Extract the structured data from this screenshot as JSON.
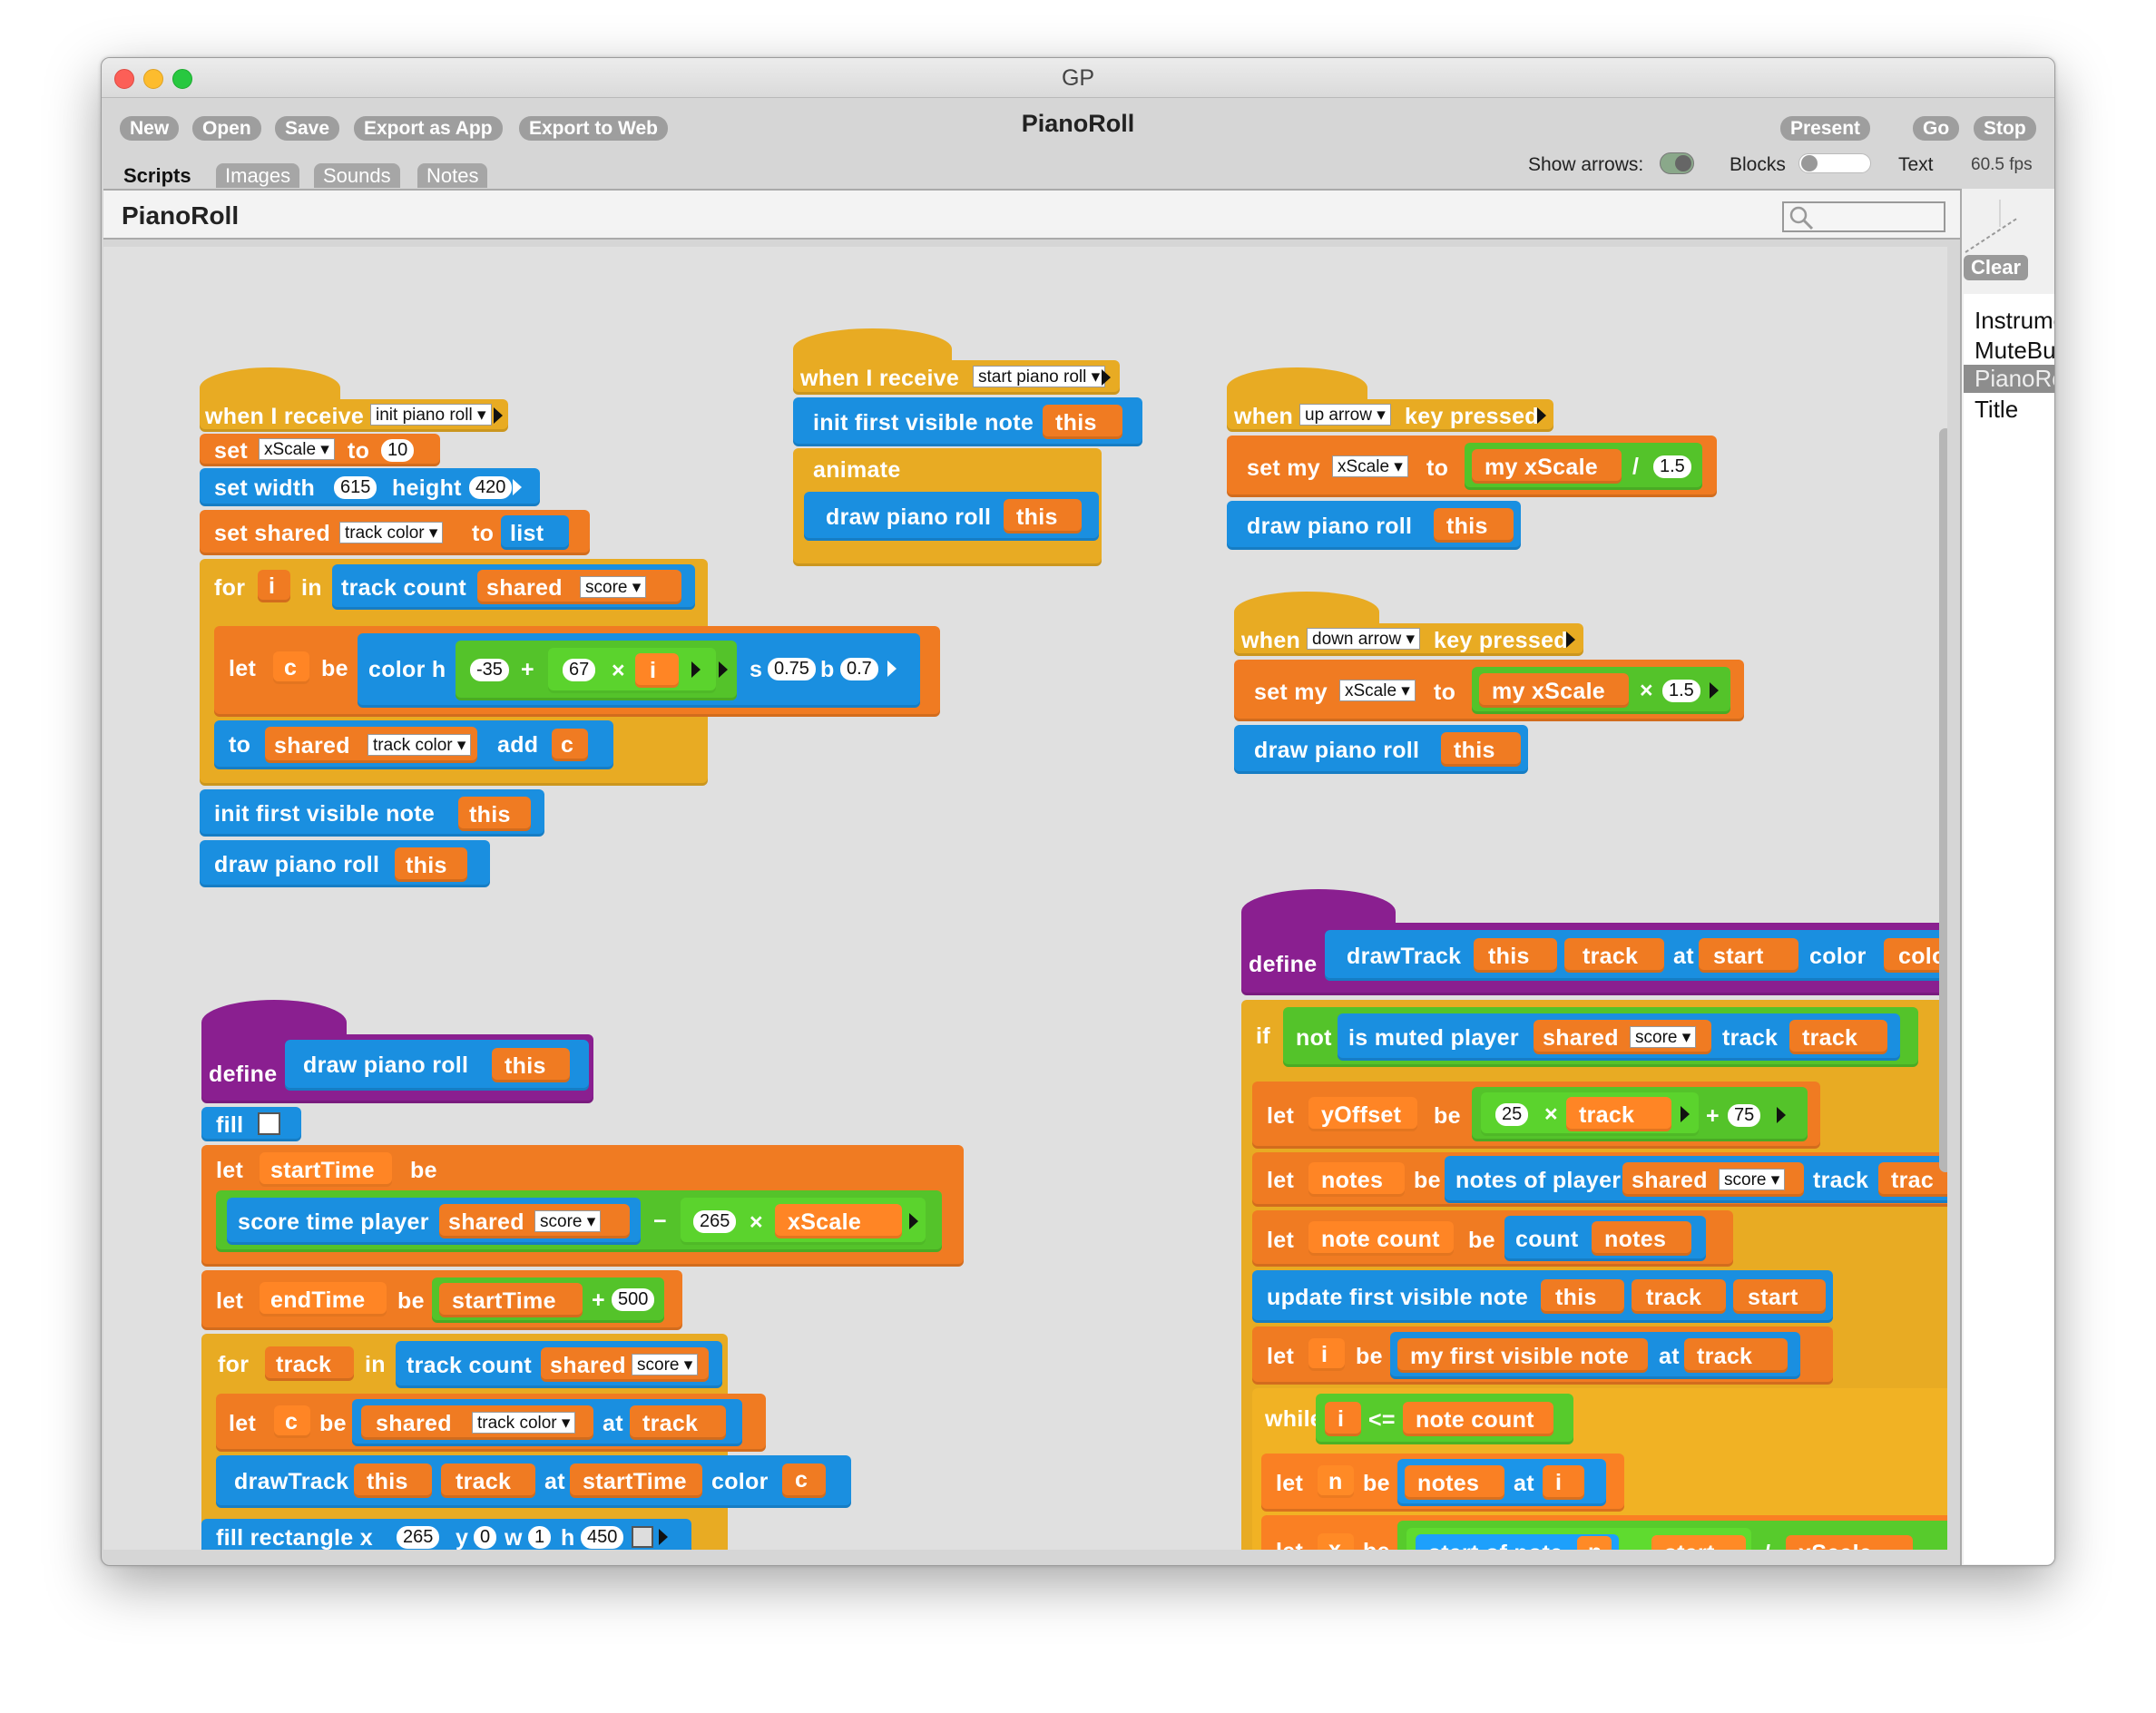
{
  "window": {
    "title": "GP",
    "project_name": "PianoRoll"
  },
  "toolbar": {
    "new": "New",
    "open": "Open",
    "save": "Save",
    "export_app": "Export as App",
    "export_web": "Export to Web",
    "present": "Present",
    "go": "Go",
    "stop": "Stop"
  },
  "tabs": {
    "scripts": "Scripts",
    "images": "Images",
    "sounds": "Sounds",
    "notes": "Notes"
  },
  "controls": {
    "show_arrows": "Show arrows:",
    "blocks": "Blocks",
    "text": "Text",
    "fps": "60.5 fps"
  },
  "header": {
    "class_name": "PianoRoll"
  },
  "right": {
    "clear": "Clear",
    "items": [
      "Instrume",
      "MuteBu",
      "PianoRo",
      "Title"
    ],
    "selected": 2
  },
  "colors": {
    "orange": "#f07b22",
    "blue": "#1a8fe0",
    "green": "#54c32a",
    "control": "#e8ab23",
    "define": "#8a1f90"
  },
  "s1": {
    "hat": "when I receive",
    "msg": "init piano roll",
    "set": "set",
    "xscale": "xScale",
    "to": "to",
    "v10": "10",
    "set_width": "set width",
    "w": "615",
    "height": "height",
    "h": "420",
    "set_shared": "set shared",
    "track_color": "track color",
    "list": "list",
    "for": "for",
    "i": "i",
    "in": "in",
    "track_count": "track count",
    "shared": "shared",
    "score": "score",
    "let": "let",
    "c": "c",
    "be": "be",
    "color_h": "color h",
    "m35": "-35",
    "plus": "+",
    "v67": "67",
    "times": "×",
    "s": "s",
    "v075": "0.75",
    "b": "b",
    "v07": "0.7",
    "to2": "to",
    "add": "add",
    "init_first": "init first visible note",
    "this": "this",
    "draw": "draw piano roll"
  },
  "s2": {
    "hat": "when I receive",
    "msg": "start piano roll",
    "init_first": "init first visible note",
    "this": "this",
    "animate": "animate",
    "draw": "draw piano roll"
  },
  "s3": {
    "when": "when",
    "key": "up arrow",
    "pressed": "key pressed",
    "set_my": "set my",
    "xscale": "xScale",
    "to": "to",
    "my_xscale": "my xScale",
    "div": "/",
    "v15": "1.5",
    "draw": "draw piano roll",
    "this": "this"
  },
  "s4": {
    "when": "when",
    "key": "down arrow",
    "pressed": "key pressed",
    "set_my": "set my",
    "xscale": "xScale",
    "to": "to",
    "my_xscale": "my xScale",
    "times": "×",
    "v15": "1.5",
    "draw": "draw piano roll",
    "this": "this"
  },
  "s5": {
    "define": "define",
    "draw": "draw piano roll",
    "this": "this",
    "fill": "fill",
    "let": "let",
    "start_time": "startTime",
    "be": "be",
    "score_time": "score time player",
    "shared": "shared",
    "score": "score",
    "minus": "−",
    "v265": "265",
    "times": "×",
    "xscale": "xScale",
    "end_time": "endTime",
    "plus": "+",
    "v500": "500",
    "for": "for",
    "track": "track",
    "in": "in",
    "track_count": "track count",
    "c": "c",
    "track_color": "track color",
    "at": "at",
    "draw_track": "drawTrack",
    "color": "color",
    "fill_rect": "fill rectangle x",
    "y": "y",
    "v0": "0",
    "w": "w",
    "v1": "1",
    "h": "h",
    "v450": "450"
  },
  "s6": {
    "define": "define",
    "draw_track": "drawTrack",
    "this": "this",
    "track": "track",
    "at": "at",
    "start": "start",
    "color": "color",
    "if": "if",
    "not": "not",
    "is_muted": "is muted player",
    "shared": "shared",
    "score": "score",
    "let": "let",
    "yoffset": "yOffset",
    "be": "be",
    "v25": "25",
    "times": "×",
    "plus": "+",
    "v75": "75",
    "notes": "notes",
    "notes_of": "notes of player",
    "trac": "trac",
    "note_count": "note count",
    "count": "count",
    "update_first": "update first visible note",
    "i": "i",
    "my_first": "my first visible note",
    "while": "while",
    "lte": "<=",
    "n": "n",
    "x": "x",
    "start_of_note": "start of note",
    "minus": "−",
    "div": "/",
    "xscale": "xScale"
  }
}
